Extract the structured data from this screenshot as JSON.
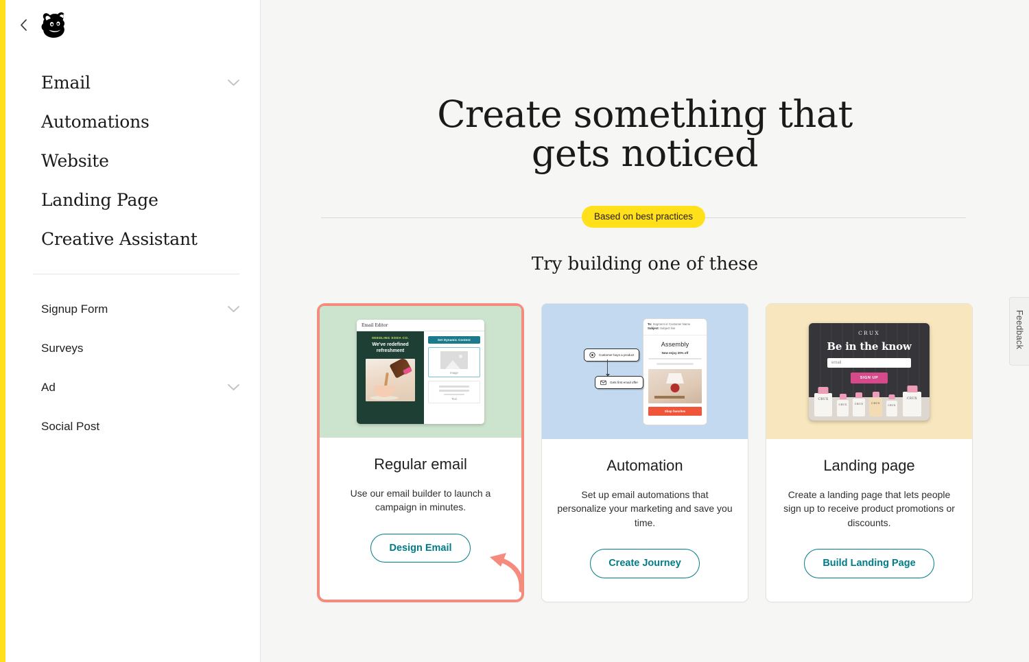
{
  "brand": {
    "logo_icon": "mailchimp-freddie-icon",
    "accent_yellow": "#FFE01B",
    "teal": "#007C89",
    "highlight_coral": "#F58B7C"
  },
  "sidebar": {
    "back_icon": "chevron-left-icon",
    "primary_items": [
      {
        "label": "Email",
        "has_chevron": true
      },
      {
        "label": "Automations",
        "has_chevron": false
      },
      {
        "label": "Website",
        "has_chevron": false
      },
      {
        "label": "Landing Page",
        "has_chevron": false
      },
      {
        "label": "Creative Assistant",
        "has_chevron": false
      }
    ],
    "secondary_items": [
      {
        "label": "Signup Form",
        "has_chevron": true
      },
      {
        "label": "Surveys",
        "has_chevron": false
      },
      {
        "label": "Ad",
        "has_chevron": true
      },
      {
        "label": "Social Post",
        "has_chevron": false
      }
    ]
  },
  "hero": {
    "title_line1": "Create something that",
    "title_line2": "gets noticed",
    "pill": "Based on best practices",
    "subhead": "Try building one of these"
  },
  "cards": [
    {
      "title": "Regular email",
      "description": "Use our email builder to launch a campaign in minutes.",
      "button": "Design Email",
      "highlighted": true,
      "thumb_bg": "#CCE3CD",
      "thumb": {
        "editor_label": "Email Editor",
        "brand_name": "SEEDLING SODA CO.",
        "headline": "We've redefined refreshment",
        "dynamic_button": "Set Dynamic Content",
        "image_block_label": "Image",
        "text_block_label": "Text"
      }
    },
    {
      "title": "Automation",
      "description": "Set up email automations that personalize your marketing and save you time.",
      "button": "Create Journey",
      "highlighted": false,
      "thumb_bg": "#C3D9EF",
      "thumb": {
        "to_line_label": "To:",
        "to_line_value": "Segment or Customer Name",
        "subject_label": "Subject:",
        "subject_value": "Subject line",
        "brand_name": "Assembly",
        "offer": "Now enjoy 20% off",
        "cta": "Shop favorites",
        "node_1": "Customer buys a product",
        "node_1_icon": "target-icon",
        "node_2": "Gets first email offer",
        "node_2_icon": "envelope-icon"
      }
    },
    {
      "title": "Landing page",
      "description": "Create a landing page that lets people sign up to receive product promotions or discounts.",
      "button": "Build Landing Page",
      "highlighted": false,
      "thumb_bg": "#F8E6BE",
      "thumb": {
        "brand_name": "CRUX",
        "headline": "Be in the know",
        "email_placeholder": "email",
        "signup_button": "SIGN UP",
        "bottle_label": "CRUX"
      }
    }
  ],
  "feedback": {
    "label": "Feedback"
  }
}
